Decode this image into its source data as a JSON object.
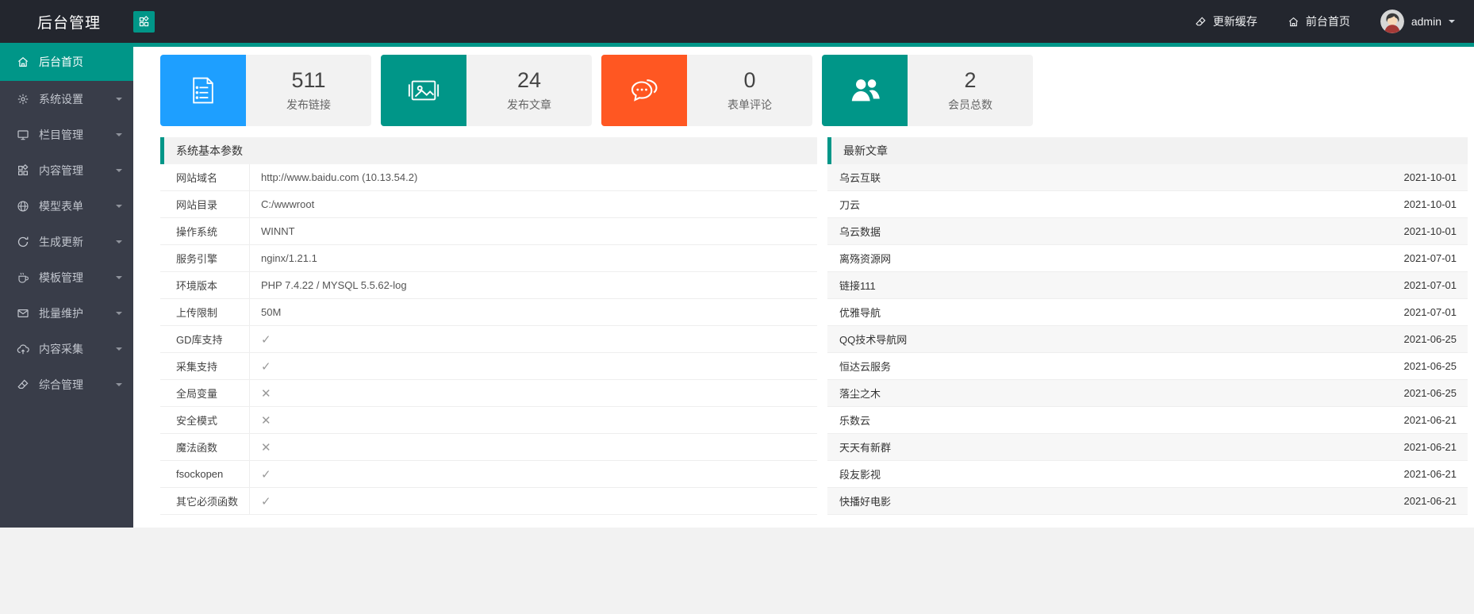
{
  "header": {
    "title": "后台管理",
    "cache_label": "更新缓存",
    "frontend_label": "前台首页",
    "username": "admin"
  },
  "sidebar": {
    "items": [
      {
        "key": "home",
        "label": "后台首页",
        "icon": "home",
        "active": true,
        "arrow": false
      },
      {
        "key": "settings",
        "label": "系统设置",
        "icon": "gear",
        "active": false,
        "arrow": true
      },
      {
        "key": "columns",
        "label": "栏目管理",
        "icon": "monitor",
        "active": false,
        "arrow": true
      },
      {
        "key": "content",
        "label": "内容管理",
        "icon": "layout",
        "active": false,
        "arrow": true
      },
      {
        "key": "forms",
        "label": "模型表单",
        "icon": "globe",
        "active": false,
        "arrow": true
      },
      {
        "key": "generate",
        "label": "生成更新",
        "icon": "refresh",
        "active": false,
        "arrow": true
      },
      {
        "key": "templates",
        "label": "模板管理",
        "icon": "cup",
        "active": false,
        "arrow": true
      },
      {
        "key": "batch",
        "label": "批量维护",
        "icon": "mail",
        "active": false,
        "arrow": true
      },
      {
        "key": "collect",
        "label": "内容采集",
        "icon": "cloud",
        "active": false,
        "arrow": true
      },
      {
        "key": "misc",
        "label": "综合管理",
        "icon": "eraser",
        "active": false,
        "arrow": true
      }
    ]
  },
  "stats": [
    {
      "value": "511",
      "label": "发布链接",
      "color": "#1E9FFF",
      "icon": "document-icon"
    },
    {
      "value": "24",
      "label": "发布文章",
      "color": "#009688",
      "icon": "image-icon"
    },
    {
      "value": "0",
      "label": "表单评论",
      "color": "#FF5722",
      "icon": "comment-icon"
    },
    {
      "value": "2",
      "label": "会员总数",
      "color": "#009688",
      "icon": "users-icon"
    }
  ],
  "system_panel": {
    "title": "系统基本参数",
    "rows": [
      {
        "label": "网站域名",
        "value": "http://www.baidu.com (10.13.54.2)"
      },
      {
        "label": "网站目录",
        "value": "C:/wwwroot"
      },
      {
        "label": "操作系统",
        "value": "WINNT"
      },
      {
        "label": "服务引擎",
        "value": "nginx/1.21.1"
      },
      {
        "label": "环境版本",
        "value": "PHP 7.4.22 / MYSQL 5.5.62-log"
      },
      {
        "label": "上传限制",
        "value": "50M"
      },
      {
        "label": "GD库支持",
        "value": "✓"
      },
      {
        "label": "采集支持",
        "value": "✓"
      },
      {
        "label": "全局变量",
        "value": "✕"
      },
      {
        "label": "安全模式",
        "value": "✕"
      },
      {
        "label": "魔法函数",
        "value": "✕"
      },
      {
        "label": "fsockopen",
        "value": "✓"
      },
      {
        "label": "其它必须函数",
        "value": "✓"
      }
    ]
  },
  "articles_panel": {
    "title": "最新文章",
    "rows": [
      {
        "title": "乌云互联",
        "date": "2021-10-01"
      },
      {
        "title": "刀云",
        "date": "2021-10-01"
      },
      {
        "title": "乌云数据",
        "date": "2021-10-01"
      },
      {
        "title": "离殇资源网",
        "date": "2021-07-01"
      },
      {
        "title": "链接111",
        "date": "2021-07-01"
      },
      {
        "title": "优雅导航",
        "date": "2021-07-01"
      },
      {
        "title": "QQ技术导航网",
        "date": "2021-06-25"
      },
      {
        "title": "恒达云服务",
        "date": "2021-06-25"
      },
      {
        "title": "落尘之木",
        "date": "2021-06-25"
      },
      {
        "title": "乐数云",
        "date": "2021-06-21"
      },
      {
        "title": "天天有新群",
        "date": "2021-06-21"
      },
      {
        "title": "段友影视",
        "date": "2021-06-21"
      },
      {
        "title": "快播好电影",
        "date": "2021-06-21"
      }
    ]
  },
  "colors": {
    "accent_teal": "#009688",
    "blue": "#1E9FFF",
    "orange": "#FF5722",
    "header_bg": "#23262e",
    "sidebar_bg": "#393d49"
  }
}
